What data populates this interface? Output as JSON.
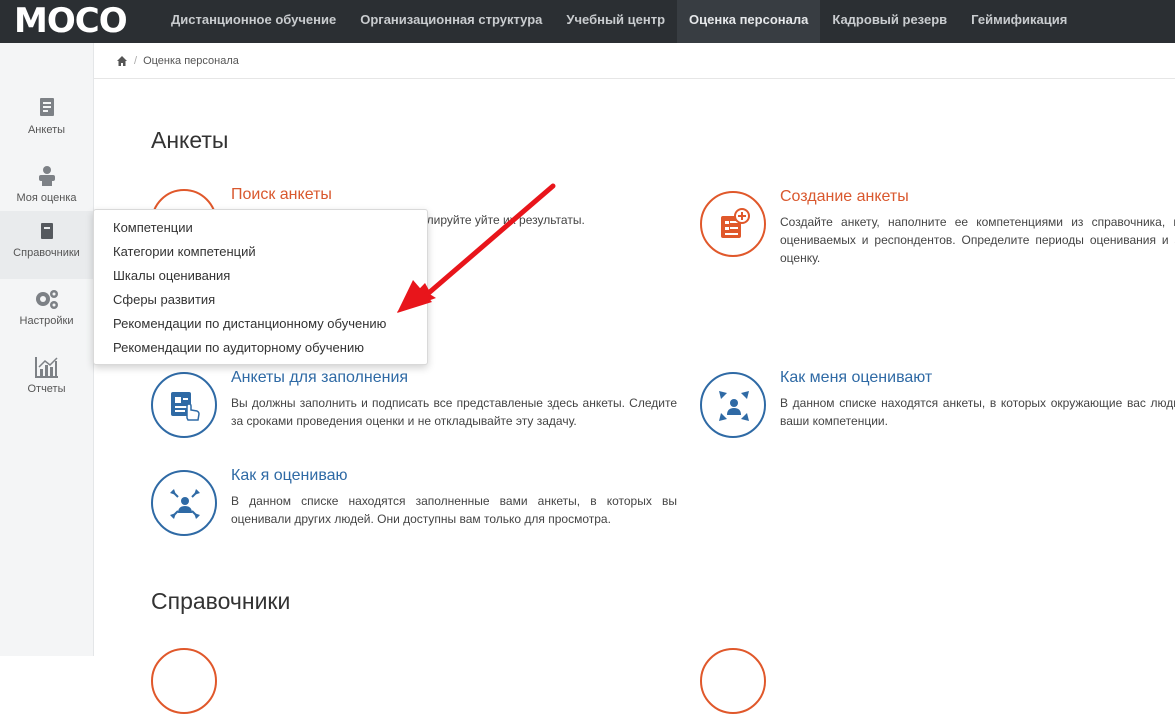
{
  "header": {
    "logo": "MOCO",
    "nav": [
      {
        "label": "Дистанционное обучение"
      },
      {
        "label": "Организационная структура"
      },
      {
        "label": "Учебный центр"
      },
      {
        "label": "Оценка персонала"
      },
      {
        "label": "Кадровый резерв"
      },
      {
        "label": "Геймификация"
      }
    ],
    "active_nav": "Оценка персонала"
  },
  "sidebar": {
    "items": [
      {
        "label": "Анкеты",
        "icon": "questionnaire-icon"
      },
      {
        "label": "Моя оценка",
        "icon": "my-rating-icon"
      },
      {
        "label": "Справочники",
        "icon": "reference-book-icon"
      },
      {
        "label": "Настройки",
        "icon": "gears-icon"
      },
      {
        "label": "Отчеты",
        "icon": "chart-icon"
      }
    ],
    "active_item": "Справочники"
  },
  "breadcrumb": {
    "home_icon": "home-icon",
    "separator": "/",
    "current": "Оценка персонала"
  },
  "main": {
    "section1_title": "Анкеты",
    "section2_title": "Справочники",
    "cards": [
      {
        "title": "Поиск анкеты",
        "desc": "для проведения оценки, проконтролируйте уйте их результаты.",
        "color": "#d9582e",
        "icon": "search-form-icon"
      },
      {
        "title": "Создание анкеты",
        "desc": "Создайте анкету, наполните ее компетенциями из справочника, н оцениваемых и респондентов. Определите периоды оценивания и з оценку.",
        "color": "#d9582e",
        "icon": "create-form-icon"
      },
      {
        "title": "Анкеты для заполнения",
        "desc": "Вы должны заполнить и подписать все представленые здесь анкеты. Следите за сроками проведения оценки и не откладывайте эту задачу.",
        "color": "#2f6aa5",
        "icon": "fill-form-icon"
      },
      {
        "title": "Как меня оценивают",
        "desc": "В данном списке находятся анкеты, в которых окружающие вас люди ваши компетенции.",
        "color": "#2f6aa5",
        "icon": "people-arrows-in-icon"
      },
      {
        "title": "Как я оцениваю",
        "desc": "В данном списке находятся заполненные вами анкеты, в которых вы оценивали других людей. Они доступны вам только для просмотра.",
        "color": "#2f6aa5",
        "icon": "people-arrows-out-icon"
      }
    ]
  },
  "dropdown": {
    "items": [
      "Компетенции",
      "Категории компетенций",
      "Шкалы оценивания",
      "Сферы развития",
      "Рекомендации по дистанционному обучению",
      "Рекомендации по аудиторному обучению"
    ]
  },
  "annotation": {
    "color": "#e8151b"
  }
}
